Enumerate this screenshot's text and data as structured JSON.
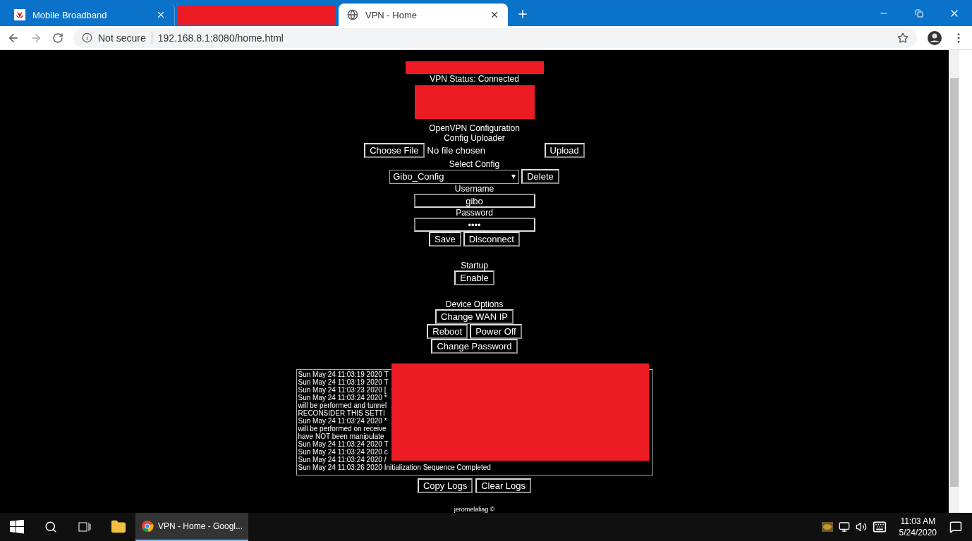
{
  "browser": {
    "tabs": [
      {
        "kind": "page",
        "title": "Mobile Broadband",
        "selected": false
      },
      {
        "kind": "redacted",
        "selected": false
      },
      {
        "kind": "page",
        "title": "VPN - Home",
        "selected": true
      }
    ],
    "address": {
      "security": "Not secure",
      "url": "192.168.8.1:8080/home.html"
    }
  },
  "page": {
    "status": "VPN Status: Connected",
    "config_title": "OpenVPN Configuration",
    "uploader_title": "Config Uploader",
    "choose_button": "Choose File",
    "file_status": "No file chosen",
    "upload_button": "Upload",
    "select_label": "Select Config",
    "select_value": "Gibo_Config",
    "delete_button": "Delete",
    "username_label": "Username",
    "username": "gibo",
    "password_label": "Password",
    "password": "••••",
    "save_button": "Save",
    "disconnect_button": "Disconnect",
    "startup_label": "Startup",
    "startup_button": "Enable",
    "device_label": "Device Options",
    "device_buttons": [
      [
        "Change WAN IP"
      ],
      [
        "Reboot",
        "Power Off"
      ],
      [
        "Change Password"
      ]
    ],
    "logs": [
      "Sun May 24 11:03:19 2020 T",
      "Sun May 24 11:03:19 2020 T",
      "Sun May 24 11:03:23 2020 [",
      "Sun May 24 11:03:24 2020 *",
      "will be performed and tunnel",
      "RECONSIDER THIS SETTI",
      "Sun May 24 11:03:24 2020 *",
      "will be performed on receive",
      "have NOT been manipulate",
      "Sun May 24 11:03:24 2020 T",
      "Sun May 24 11:03:24 2020 c",
      "Sun May 24 11:03:24 2020 /",
      "Sun May 24 11:03:26 2020 Initialization Sequence Completed"
    ],
    "log_buttons": [
      "Copy Logs",
      "Clear Logs"
    ],
    "footer": "jeromelaliag ©"
  },
  "taskbar": {
    "app": "VPN - Home - Googl...",
    "time": "11:03 AM",
    "date": "5/24/2020"
  }
}
